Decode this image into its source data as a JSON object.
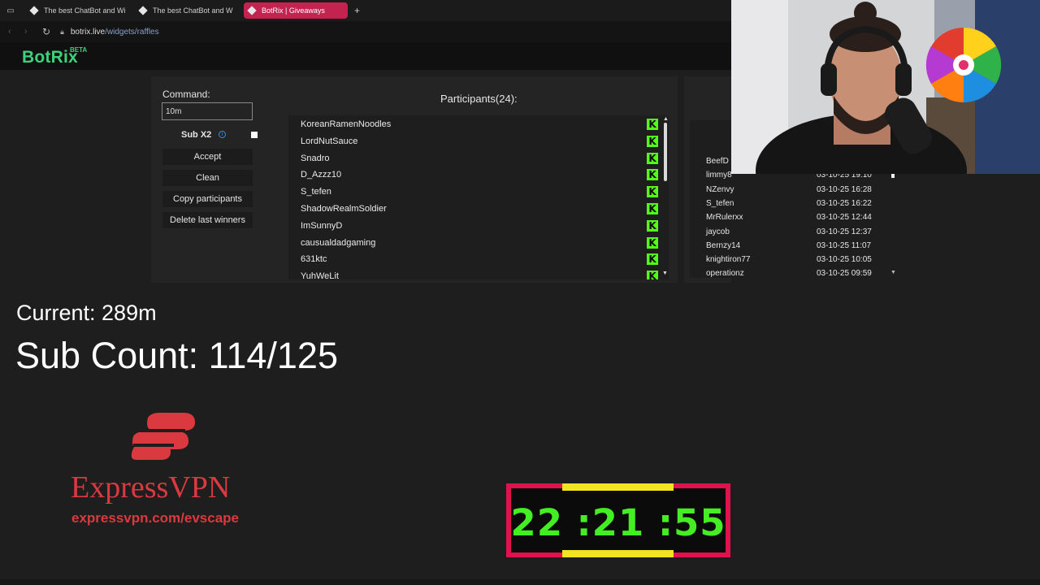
{
  "browser": {
    "tabs": [
      {
        "label": "The best ChatBot and Wi"
      },
      {
        "label": "The best ChatBot and W"
      },
      {
        "label": "BotRix | Giveaways",
        "active": true
      }
    ],
    "url_host": "botrix.live",
    "url_path": "/widgets/raffles"
  },
  "app": {
    "logo": "BotRix",
    "logo_badge": "BETA"
  },
  "raffle": {
    "command_label": "Command:",
    "command_value": "10m",
    "sub_x2_label": "Sub X2",
    "buttons": {
      "accept": "Accept",
      "clean": "Clean",
      "copy": "Copy participants",
      "delete": "Delete last winners"
    },
    "participants_title": "Participants(24):",
    "participants": [
      "KoreanRamenNoodles",
      "LordNutSauce",
      "Snadro",
      "D_Azzz10",
      "S_tefen",
      "ShadowRealmSoldier",
      "ImSunnyD",
      "causualdadgaming",
      "631ktc",
      "YuhWeLit"
    ],
    "platform_badge": "K"
  },
  "winners": [
    {
      "name": "BeefD",
      "date": ""
    },
    {
      "name": "limmy8",
      "date": "03-10-25 19:10"
    },
    {
      "name": "NZenvy",
      "date": "03-10-25 16:28"
    },
    {
      "name": "S_tefen",
      "date": "03-10-25 16:22"
    },
    {
      "name": "MrRulerxx",
      "date": "03-10-25 12:44"
    },
    {
      "name": "jaycob",
      "date": "03-10-25 12:37"
    },
    {
      "name": "Bernzy14",
      "date": "03-10-25 11:07"
    },
    {
      "name": "knightiron77",
      "date": "03-10-25 10:05"
    },
    {
      "name": "operationz",
      "date": "03-10-25 09:59"
    }
  ],
  "overlay": {
    "current": "Current: 289m",
    "sub_count": "Sub Count: 114/125",
    "sponsor_name": "ExpressVPN",
    "sponsor_url": "expressvpn.com/evscape",
    "timer": "22 :21 :55"
  },
  "colors": {
    "accent_tab": "#c5234f",
    "brand_green": "#3fd07a",
    "kick_green": "#53fc18",
    "sponsor_red": "#da3940",
    "timer_green": "#44ee22",
    "timer_frame": "#e0124e",
    "timer_accent": "#f4e320"
  }
}
